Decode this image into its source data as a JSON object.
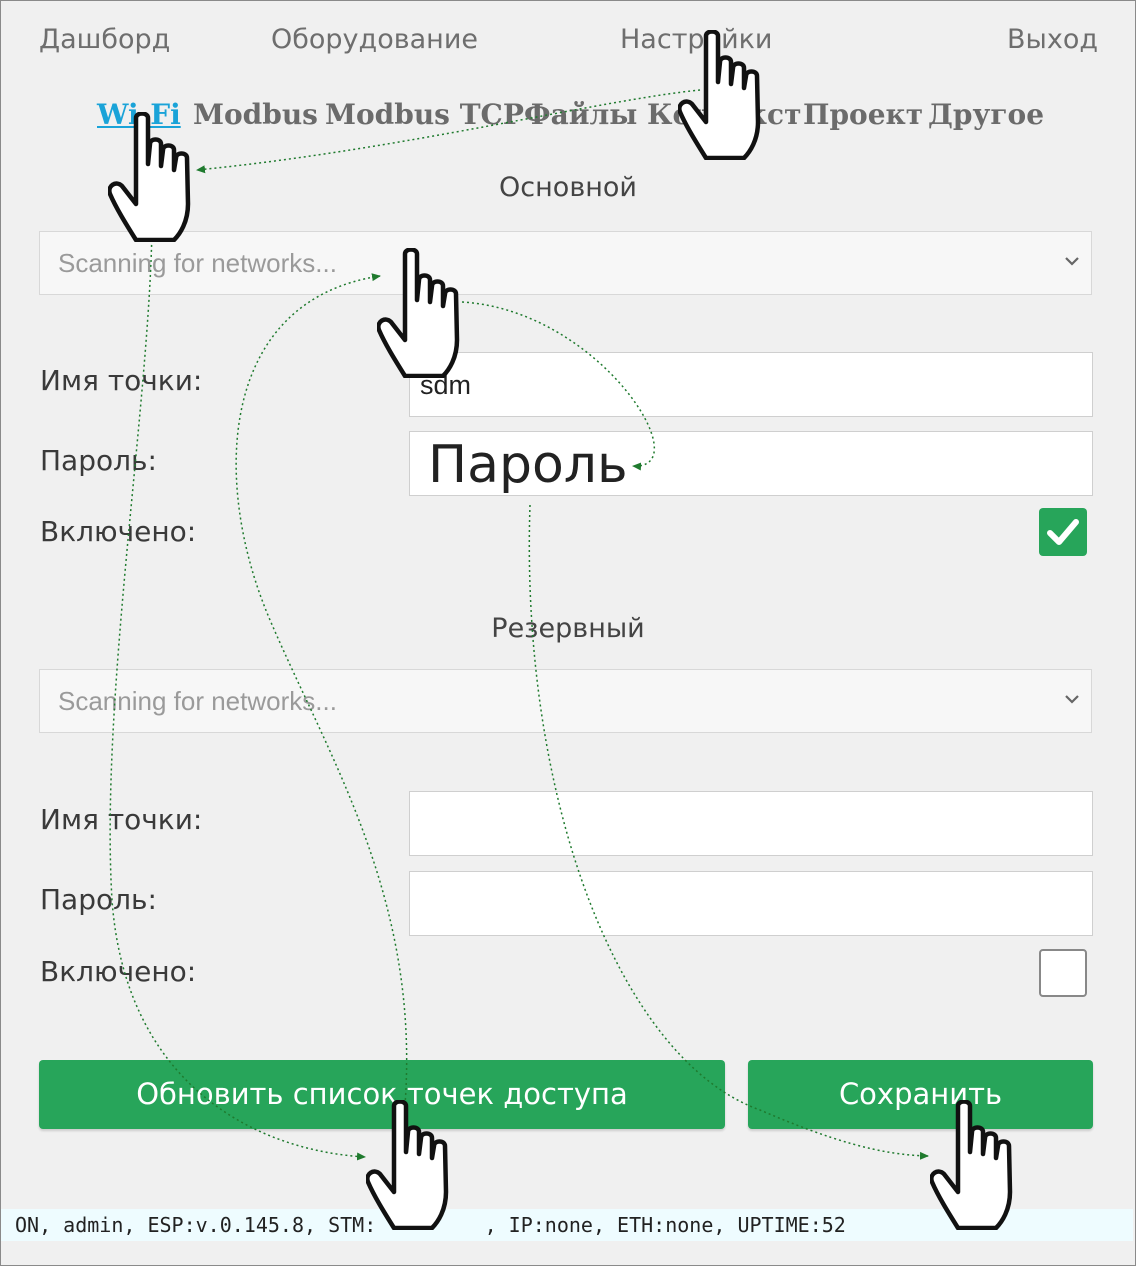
{
  "nav": {
    "dashboard": "Дашборд",
    "equipment": "Оборудование",
    "settings": "Настройки",
    "logout": "Выход"
  },
  "tabs": [
    {
      "label": "Wi-Fi",
      "active": true
    },
    {
      "label": "Modbus",
      "active": false
    },
    {
      "label": "Modbus TCP",
      "active": false
    },
    {
      "label": "Файлы",
      "active": false
    },
    {
      "label": "Контекст",
      "active": false
    },
    {
      "label": "Проект",
      "active": false
    },
    {
      "label": "Другое",
      "active": false
    }
  ],
  "primary": {
    "title": "Основной",
    "network_select": "Scanning for networks...",
    "ssid_label": "Имя точки:",
    "ssid_value": "sdm",
    "password_label": "Пароль:",
    "password_placeholder": "Пароль",
    "enabled_label": "Включено:",
    "enabled": true
  },
  "backup": {
    "title": "Резервный",
    "network_select": "Scanning for networks...",
    "ssid_label": "Имя точки:",
    "ssid_value": "",
    "password_label": "Пароль:",
    "enabled_label": "Включено:",
    "enabled": false
  },
  "buttons": {
    "refresh": "Обновить список точек доступа",
    "save": "Сохранить"
  },
  "status_bar": "ON, admin, ESP:v.0.145.8, STM:         , IP:none, ETH:none, UPTIME:52",
  "colors": {
    "accent_green": "#27a55a",
    "active_tab": "#1aa3d8",
    "status_bg": "#eefcff",
    "annotation_arrow": "#1f7a2e"
  },
  "icons": [
    "hand-pointer-icon",
    "checkmark-icon",
    "chevron-down-icon"
  ]
}
